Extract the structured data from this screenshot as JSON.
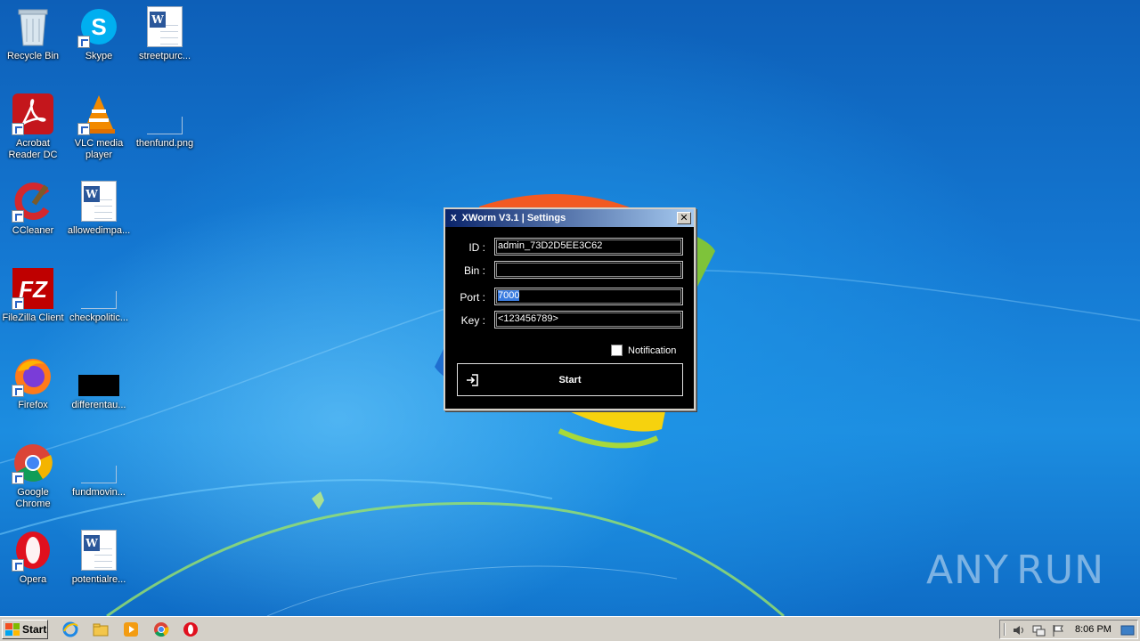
{
  "desktop": {
    "icons": [
      {
        "label": "Recycle Bin",
        "icon": "recycle-bin-icon"
      },
      {
        "label": "Skype",
        "icon": "skype-icon"
      },
      {
        "label": "streetpurc...",
        "icon": "word-document-icon"
      },
      {
        "label": "Acrobat Reader DC",
        "icon": "acrobat-reader-icon"
      },
      {
        "label": "VLC media player",
        "icon": "vlc-icon"
      },
      {
        "label": "thenfund.png",
        "icon": "png-file-icon"
      },
      {
        "label": "CCleaner",
        "icon": "ccleaner-icon"
      },
      {
        "label": "allowedimpa...",
        "icon": "word-document-icon"
      },
      {
        "label": "FileZilla Client",
        "icon": "filezilla-icon"
      },
      {
        "label": "checkpolitic...",
        "icon": "file-icon"
      },
      {
        "label": "Firefox",
        "icon": "firefox-icon"
      },
      {
        "label": "differentau...",
        "icon": "image-file-icon"
      },
      {
        "label": "Google Chrome",
        "icon": "chrome-icon"
      },
      {
        "label": "fundmovin...",
        "icon": "file-icon"
      },
      {
        "label": "Opera",
        "icon": "opera-icon"
      },
      {
        "label": "potentialre...",
        "icon": "word-document-icon"
      }
    ]
  },
  "window": {
    "title_icon": "X",
    "title": "XWorm V3.1 | Settings",
    "close_label": "✕",
    "fields": {
      "id": {
        "label": "ID :",
        "value": "admin_73D2D5EE3C62"
      },
      "bin": {
        "label": "Bin :",
        "value": ""
      },
      "port": {
        "label": "Port :",
        "value": "7000"
      },
      "key": {
        "label": "Key :",
        "value": "<123456789>"
      }
    },
    "notification_label": "Notification",
    "notification_checked": false,
    "start_label": "Start"
  },
  "watermark": {
    "text_left": "ANY",
    "text_right": "RUN"
  },
  "taskbar": {
    "start_label": "Start",
    "pinned": [
      "internet-explorer-icon",
      "explorer-folder-icon",
      "media-player-icon",
      "chrome-icon",
      "opera-icon"
    ],
    "clock": "8:06 PM"
  },
  "colors": {
    "window_bg": "#000000",
    "titlebar_start": "#0a246a",
    "titlebar_end": "#a6caf0",
    "taskbar": "#d4d0c8"
  }
}
